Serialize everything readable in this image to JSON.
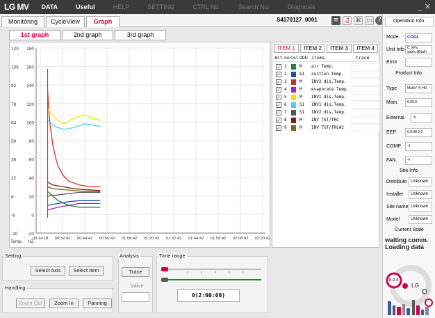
{
  "app": {
    "logo": "LG MV",
    "menu": [
      "DATA",
      "Useful",
      "HELP",
      "SETTING",
      "CTRL No.",
      "Search No.",
      "Diagnosis"
    ],
    "menu_dim": [
      false,
      false,
      true,
      true,
      true,
      true,
      true
    ],
    "close_label": "_ ✕"
  },
  "main_tabs": [
    "Monitoring",
    "CycleView",
    "Graph"
  ],
  "serial": "S4170127_0001",
  "graph_tabs": [
    "1st graph",
    "2nd graph",
    "3rd graph"
  ],
  "chart_data": {
    "type": "line",
    "y_left_ticks": [
      120,
      106,
      92,
      78,
      64,
      50,
      36,
      22,
      8,
      -6,
      -20
    ],
    "y_right_ticks": [
      180,
      160,
      140,
      120,
      100,
      80,
      60,
      40,
      20,
      0,
      -20
    ],
    "y_left_axis_label": "Temp.",
    "y_right_axis_label": "HZ",
    "x_ticks": [
      "00:14:18",
      "00:32:42",
      "00:44:42",
      "00:56:42",
      "01:08:42",
      "01:20:42",
      "01:32:42",
      "01:44:42",
      "01:56:42",
      "02:08:42",
      "02:20:42"
    ],
    "y_range": [
      -20,
      180
    ],
    "grid": true,
    "series": [
      {
        "name": "air Temp.",
        "color": "#2e7d32",
        "x": [
          0,
          0.2,
          0.4,
          0.6,
          1.0
        ],
        "y": [
          25,
          15,
          10,
          8,
          8
        ]
      },
      {
        "name": "suction Temp.",
        "color": "#1f4fa8",
        "x": [
          0,
          0.2,
          0.4,
          0.6,
          1.0
        ],
        "y": [
          10,
          12,
          14,
          15,
          15
        ]
      },
      {
        "name": "INV2 dis.Temp.",
        "color": "#d32f2f",
        "x": [
          0,
          0.02,
          0.05,
          0.1,
          0.15,
          0.2,
          0.3,
          0.4,
          0.6,
          0.8,
          1.0
        ],
        "y": [
          135,
          115,
          95,
          75,
          62,
          52,
          42,
          36,
          32,
          30,
          30
        ]
      },
      {
        "name": "evaporate Temp.",
        "color": "#9c27b0",
        "x": [
          0,
          0.2,
          0.4,
          0.6,
          1.0
        ],
        "y": [
          5,
          8,
          10,
          12,
          12
        ]
      },
      {
        "name": "INV1 dis.Temp.",
        "color": "#e8e800",
        "x": [
          0,
          0.08,
          0.15,
          0.3,
          0.5,
          0.7,
          0.85,
          1.0
        ],
        "y": [
          115,
          108,
          104,
          98,
          104,
          108,
          104,
          102
        ]
      },
      {
        "name": "INV1 dis.Temp.",
        "color": "#4dd0e1",
        "x": [
          0,
          0.08,
          0.15,
          0.3,
          0.5,
          0.7,
          0.85,
          1.0
        ],
        "y": [
          102,
          98,
          95,
          92,
          94,
          98,
          97,
          95
        ]
      },
      {
        "name": "INV2 dis.Temp.",
        "color": "#555555",
        "x": [
          0,
          0.3,
          0.6,
          1.0
        ],
        "y": [
          20,
          22,
          24,
          24
        ]
      },
      {
        "name": "INV TGT/TRC",
        "color": "#8b1a1a",
        "x": [
          0,
          0.1,
          0.3,
          0.5,
          0.7,
          1.0
        ],
        "y": [
          35,
          32,
          30,
          28,
          27,
          26
        ]
      },
      {
        "name": "INV TGT/TRC#2",
        "color": "#7a6a1a",
        "x": [
          0,
          0.1,
          0.3,
          0.5,
          0.7,
          1.0
        ],
        "y": [
          30,
          28,
          27,
          26,
          25,
          25
        ]
      }
    ]
  },
  "item_tabs": [
    "ITEM 1",
    "ITEM 2",
    "ITEM 3",
    "ITEM 4"
  ],
  "item_headers": {
    "act": "Act",
    "no": "no",
    "col": "Col",
    "odu": "ODU",
    "items": "items",
    "trace": "trace"
  },
  "items": [
    {
      "no": "1",
      "color": "#2e7d32",
      "odu": "M",
      "name": "air Temp."
    },
    {
      "no": "2",
      "color": "#1f4fa8",
      "odu": "S1",
      "name": "suction Temp."
    },
    {
      "no": "3",
      "color": "#d32f2f",
      "odu": "M",
      "name": "INV2 dis.Temp."
    },
    {
      "no": "4",
      "color": "#9c27b0",
      "odu": "M",
      "name": "evaporate Temp."
    },
    {
      "no": "5",
      "color": "#e8e800",
      "odu": "M",
      "name": "INV1 dis.Temp."
    },
    {
      "no": "6",
      "color": "#4dd0e1",
      "odu": "S1",
      "name": "INV1 dis.Temp."
    },
    {
      "no": "7",
      "color": "#555555",
      "odu": "S1",
      "name": "INV2 dis.Temp."
    },
    {
      "no": "8",
      "color": "#8b1a1a",
      "odu": "M",
      "name": "INV TGT/TRC"
    },
    {
      "no": "9",
      "color": "#7a6a1a",
      "odu": "M",
      "name": "INV TGT/TRC#2"
    }
  ],
  "setting": {
    "title": "Setting",
    "select_axis": "Select Axis",
    "select_item": "Select Item"
  },
  "handling": {
    "title": "Handling",
    "zoom_out": "Zoom Out",
    "zoom_in": "Zoom In",
    "panning": "Panning"
  },
  "analysis": {
    "title": "Analysis",
    "trace": "Trace",
    "value_label": "Value"
  },
  "time_range": {
    "title": "Time range",
    "value": "0(2:00:00)"
  },
  "right": {
    "operation_info": "Operation Info.",
    "mode_label": "Mode",
    "mode_value": "COOL",
    "unit_info_label": "Unit Info.",
    "unit_info_value": "C_kPa  sub/n.kBtu/h",
    "error_label": "Error",
    "error_value": "-",
    "product_info": "Product Info.",
    "type_label": "Type",
    "type_value": "MultiV IV HR",
    "main_label": "Main.",
    "main_value": "0.00.0",
    "external_label": "External.",
    "external_value": "-#",
    "eep_label": "EEP.",
    "eep_value": "0.0.00.0.0",
    "comp_label": "COMP.",
    "comp_value": "-#",
    "fan_label": "FAN.",
    "fan_value": "-#",
    "site_info": "Site Info.",
    "distributor_label": "Distributo",
    "distributor_value": "Unknown",
    "installer_label": "Installer",
    "installer_value": "Unknown",
    "site_name_label": "Site name",
    "site_name_value": "Unknown",
    "model_label": "Model",
    "model_value": "Unknown",
    "current_state": "Current State",
    "state_text": "waiting comm. Loading data",
    "version": "8.0.4",
    "brand": "LG"
  }
}
